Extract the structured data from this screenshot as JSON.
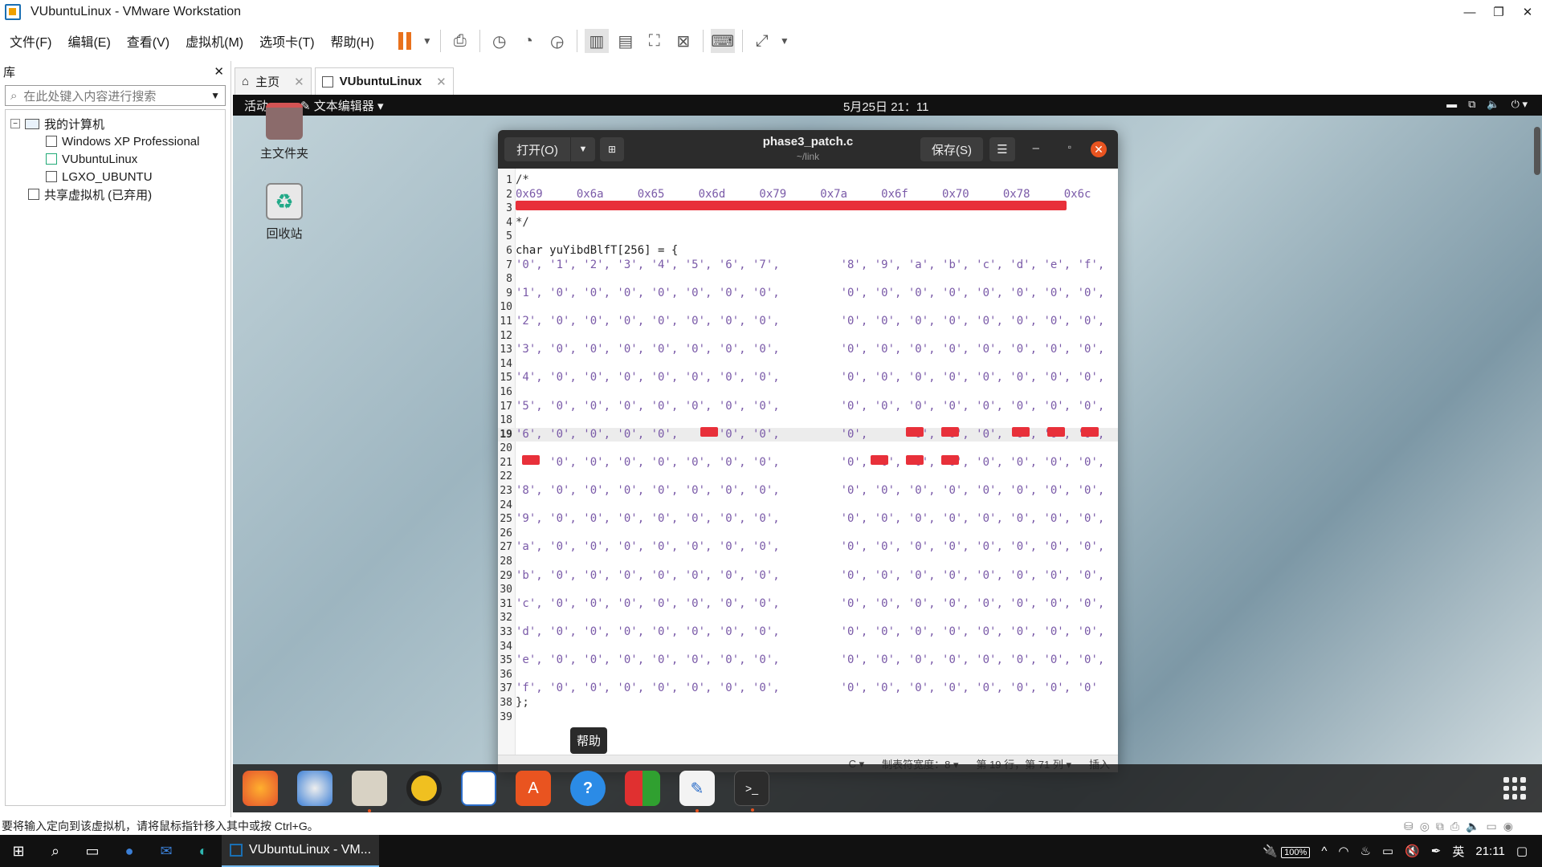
{
  "window": {
    "title": "VUbuntuLinux - VMware Workstation"
  },
  "menu": {
    "items": [
      "文件(F)",
      "编辑(E)",
      "查看(V)",
      "虚拟机(M)",
      "选项卡(T)",
      "帮助(H)"
    ]
  },
  "library": {
    "title": "库",
    "search_placeholder": "在此处键入内容进行搜索",
    "tree": {
      "root": "我的计算机",
      "vms": [
        "Windows XP Professional",
        "VUbuntuLinux",
        "LGXO_UBUNTU"
      ],
      "shared": "共享虚拟机 (已弃用)"
    }
  },
  "tabs": [
    {
      "label": "主页"
    },
    {
      "label": "VUbuntuLinux"
    }
  ],
  "guest": {
    "activities": "活动",
    "app_menu": "文本编辑器",
    "clock": "5月25日 21：11",
    "desktop_icons": [
      "主文件夹",
      "回收站"
    ],
    "help_tooltip": "帮助"
  },
  "editor": {
    "open_label": "打开(O)",
    "save_label": "保存(S)",
    "filename": "phase3_patch.c",
    "path": "~/link",
    "status": {
      "language": "C",
      "tab_width": "制表符宽度：8",
      "position": "第 19 行，第 71 列",
      "mode": "插入"
    },
    "lines": [
      {
        "n": "1",
        "text": "/*"
      },
      {
        "n": "2",
        "text": "0x69     0x6a     0x65     0x6d     0x79     0x7a     0x6f     0x70     0x78     0x6c"
      },
      {
        "n": "3",
        "text": ""
      },
      {
        "n": "4",
        "text": "*/"
      },
      {
        "n": "5",
        "text": ""
      },
      {
        "n": "6",
        "text": "char yuYibdBlfT[256] = {"
      },
      {
        "n": "7",
        "text": "'0', '1', '2', '3', '4', '5', '6', '7',         '8', '9', 'a', 'b', 'c', 'd', 'e', 'f',"
      },
      {
        "n": "8",
        "text": ""
      },
      {
        "n": "9",
        "text": "'1', '0', '0', '0', '0', '0', '0', '0',         '0', '0', '0', '0', '0', '0', '0', '0',"
      },
      {
        "n": "10",
        "text": ""
      },
      {
        "n": "11",
        "text": "'2', '0', '0', '0', '0', '0', '0', '0',         '0', '0', '0', '0', '0', '0', '0', '0',"
      },
      {
        "n": "12",
        "text": ""
      },
      {
        "n": "13",
        "text": "'3', '0', '0', '0', '0', '0', '0', '0',         '0', '0', '0', '0', '0', '0', '0', '0',"
      },
      {
        "n": "14",
        "text": ""
      },
      {
        "n": "15",
        "text": "'4', '0', '0', '0', '0', '0', '0', '0',         '0', '0', '0', '0', '0', '0', '0', '0',"
      },
      {
        "n": "16",
        "text": ""
      },
      {
        "n": "17",
        "text": "'5', '0', '0', '0', '0', '0', '0', '0',         '0', '0', '0', '0', '0', '0', '0', '0',"
      },
      {
        "n": "18",
        "text": ""
      },
      {
        "n": "19",
        "text": "'6', '0', '0', '0', '0',      '0', '0',         '0',      '0', '0', '0', '0', '0', '0',"
      },
      {
        "n": "20",
        "text": ""
      },
      {
        "n": "21",
        "text": "     '0', '0', '0', '0', '0', '0', '0',         '0', '0', '0', '0', '0', '0', '0', '0',"
      },
      {
        "n": "22",
        "text": ""
      },
      {
        "n": "23",
        "text": "'8', '0', '0', '0', '0', '0', '0', '0',         '0', '0', '0', '0', '0', '0', '0', '0',"
      },
      {
        "n": "24",
        "text": ""
      },
      {
        "n": "25",
        "text": "'9', '0', '0', '0', '0', '0', '0', '0',         '0', '0', '0', '0', '0', '0', '0', '0',"
      },
      {
        "n": "26",
        "text": ""
      },
      {
        "n": "27",
        "text": "'a', '0', '0', '0', '0', '0', '0', '0',         '0', '0', '0', '0', '0', '0', '0', '0',"
      },
      {
        "n": "28",
        "text": ""
      },
      {
        "n": "29",
        "text": "'b', '0', '0', '0', '0', '0', '0', '0',         '0', '0', '0', '0', '0', '0', '0', '0',"
      },
      {
        "n": "30",
        "text": ""
      },
      {
        "n": "31",
        "text": "'c', '0', '0', '0', '0', '0', '0', '0',         '0', '0', '0', '0', '0', '0', '0', '0',"
      },
      {
        "n": "32",
        "text": ""
      },
      {
        "n": "33",
        "text": "'d', '0', '0', '0', '0', '0', '0', '0',         '0', '0', '0', '0', '0', '0', '0', '0',"
      },
      {
        "n": "34",
        "text": ""
      },
      {
        "n": "35",
        "text": "'e', '0', '0', '0', '0', '0', '0', '0',         '0', '0', '0', '0', '0', '0', '0', '0',"
      },
      {
        "n": "36",
        "text": ""
      },
      {
        "n": "37",
        "text": "'f', '0', '0', '0', '0', '0', '0', '0',         '0', '0', '0', '0', '0', '0', '0', '0'"
      },
      {
        "n": "38",
        "text": "};"
      },
      {
        "n": "39",
        "text": ""
      }
    ]
  },
  "vmware_status": "要将输入定向到该虚拟机，请将鼠标指针移入其中或按 Ctrl+G。",
  "taskbar": {
    "app_label": "VUbuntuLinux - VM...",
    "battery": "100%",
    "ime": "英",
    "time": "21:11"
  },
  "colors": {
    "accent": "#e95420",
    "highlight_red": "#e8303a"
  }
}
